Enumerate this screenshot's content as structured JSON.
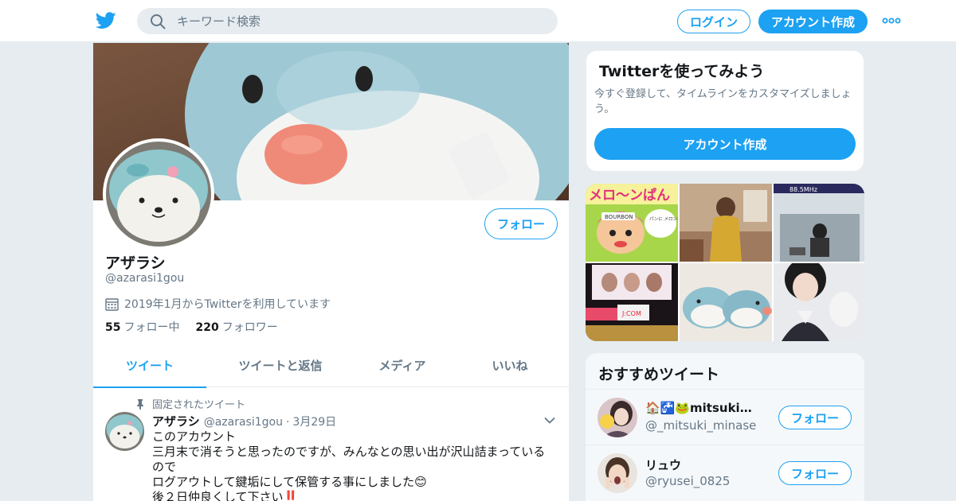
{
  "colors": {
    "accent": "#1da1f2",
    "muted": "#657786",
    "text": "#14171a",
    "bg": "#e6ecf0"
  },
  "header": {
    "logo_icon": "twitter-bird-icon",
    "search_placeholder": "キーワード検索",
    "login_label": "ログイン",
    "signup_label": "アカウント作成",
    "more_icon": "more-dots-icon"
  },
  "profile": {
    "name": "アザラシ",
    "handle": "@azarasi1gou",
    "joined": "2019年1月からTwitterを利用しています",
    "following_count": "55",
    "following_label": "フォロー中",
    "followers_count": "220",
    "followers_label": "フォロワー",
    "follow_label": "フォロー"
  },
  "tabs": [
    {
      "label": "ツイート",
      "active": true
    },
    {
      "label": "ツイートと返信",
      "active": false
    },
    {
      "label": "メディア",
      "active": false
    },
    {
      "label": "いいね",
      "active": false
    }
  ],
  "tweet": {
    "pinned_label": "固定されたツイート",
    "author_name": "アザラシ",
    "author_handle": "@azarasi1gou",
    "separator": "·",
    "date": "3月29日",
    "lines": [
      "このアカウント",
      "三月末で消そうと思ったのですが、みんなとの思い出が沢山詰まっている",
      "ので",
      "ログアウトして鍵垢にして保管する事にしました😊",
      "後２日仲良くして下さい‼️"
    ]
  },
  "signup_card": {
    "title": "Twitterを使ってみよう",
    "description": "今すぐ登録して、タイムラインをカスタマイズしましょう。",
    "button_label": "アカウント作成"
  },
  "media": {
    "tile_texts": [
      "メロ〜ンぱん",
      "BOURBON",
      "パンに メロン果汁が 入ってるよ!",
      "88.5MHz",
      "J:COM"
    ]
  },
  "recommended": {
    "title": "おすすめツイート",
    "follow_label": "フォロー",
    "accounts": [
      {
        "name": "🏠🚰🐸mitsuki🐺…",
        "handle": "@_mitsuki_minase"
      },
      {
        "name": "リュウ",
        "handle": "@ryusei_0825"
      }
    ]
  }
}
